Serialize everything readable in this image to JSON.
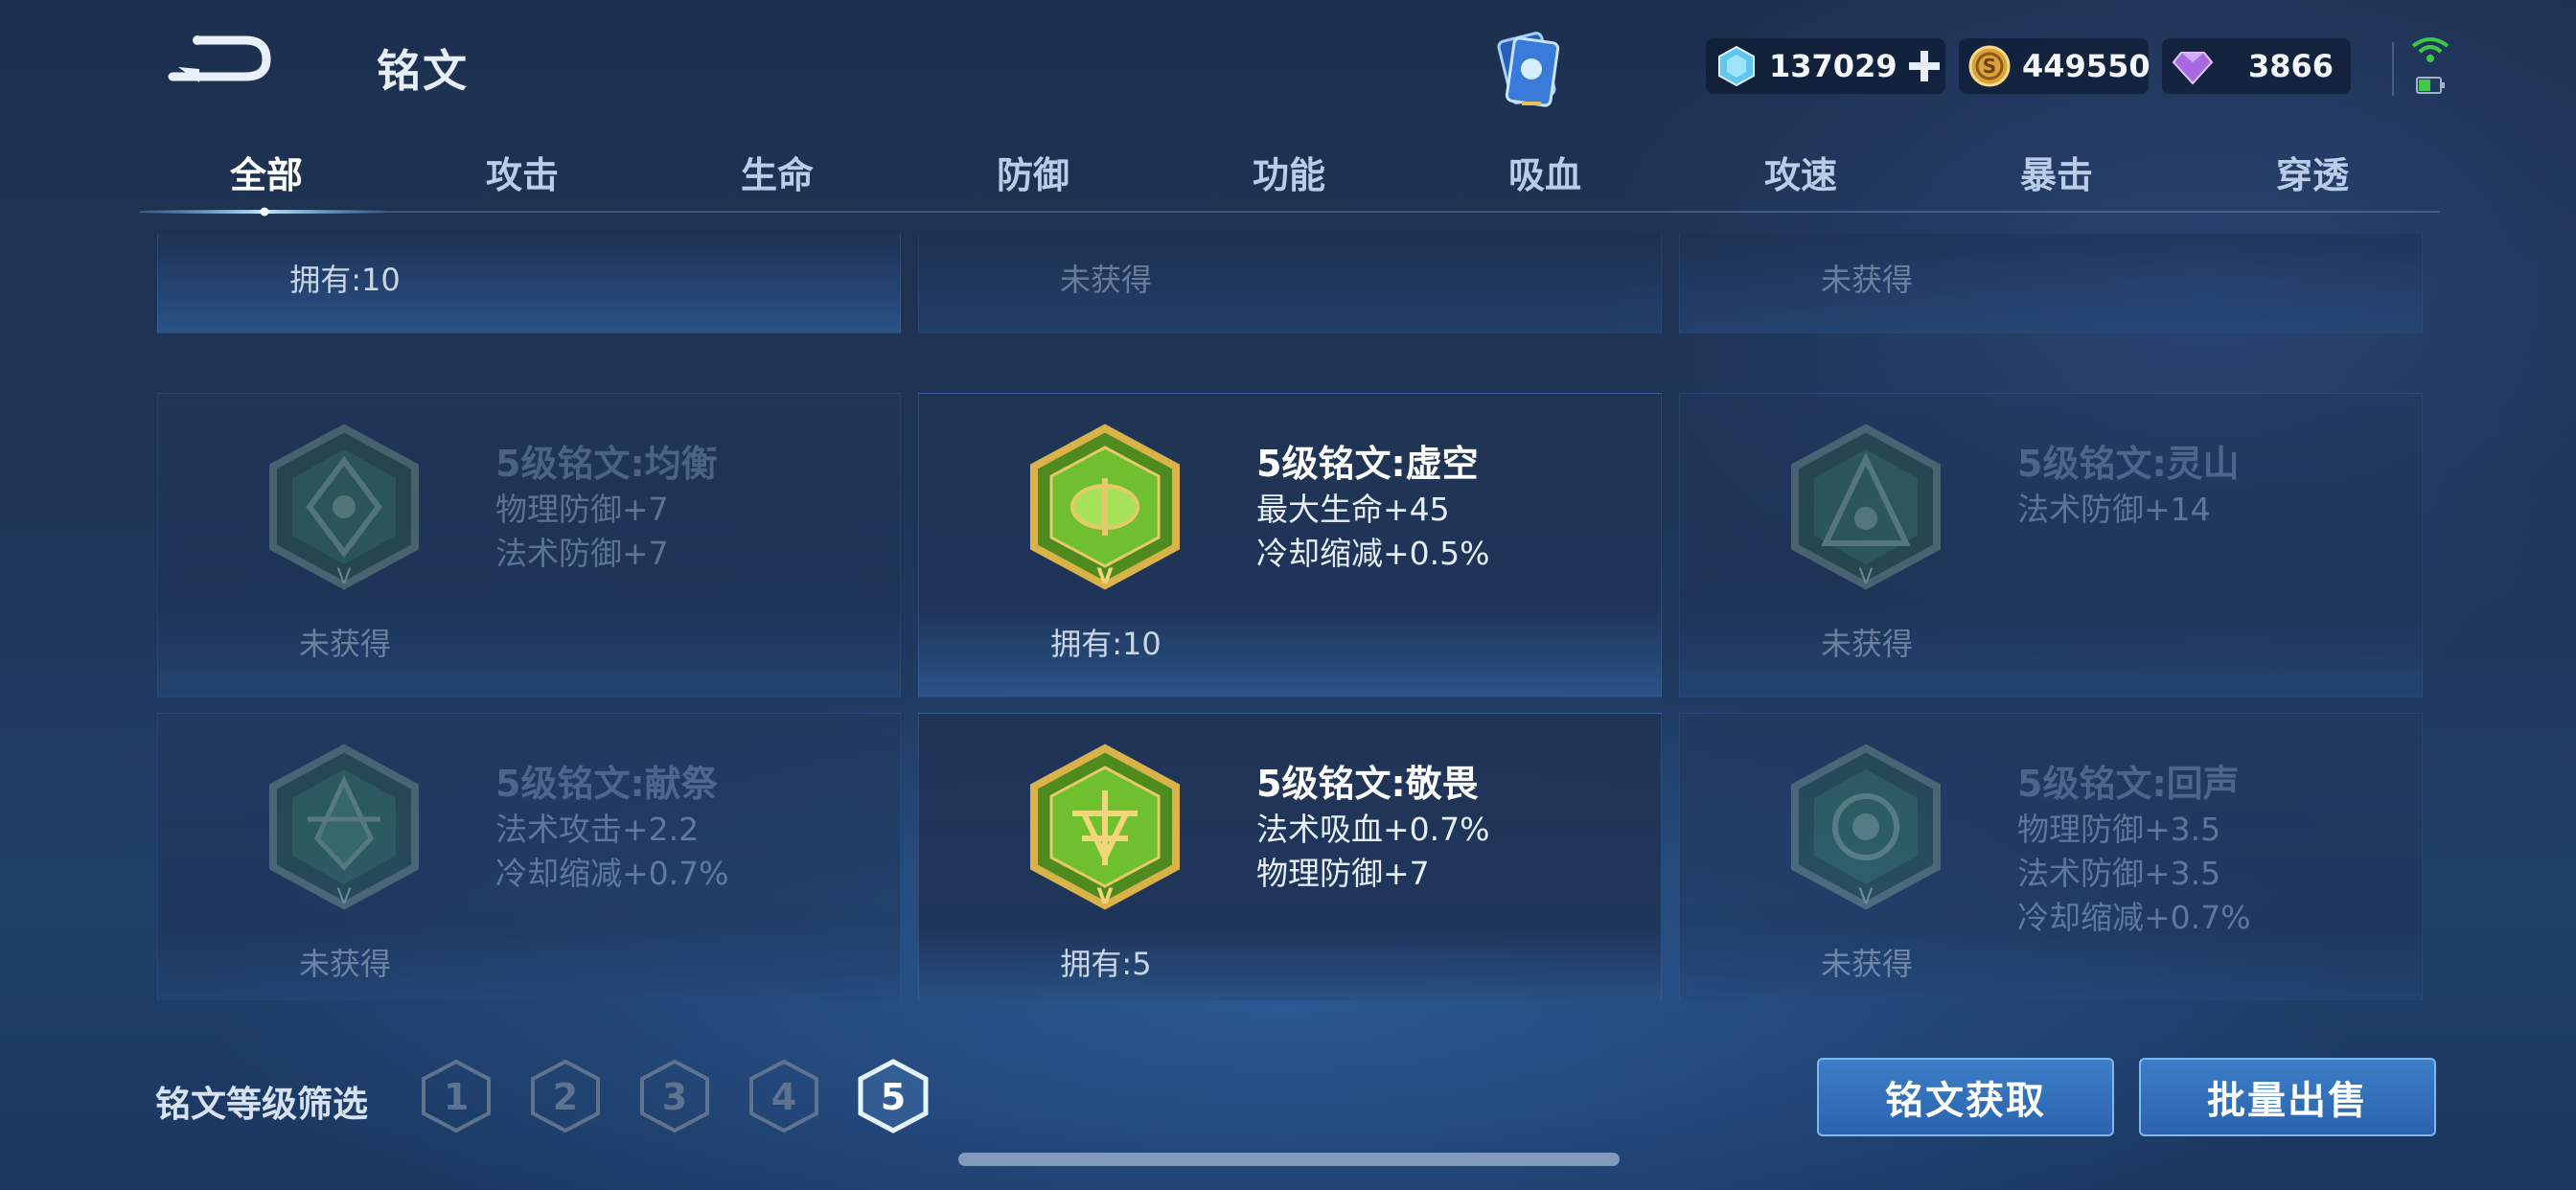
{
  "header": {
    "title": "铭文",
    "currencies": [
      {
        "name": "voucher",
        "value": "137029",
        "icon": "voucher-crystal-icon",
        "has_add": true
      },
      {
        "name": "gold",
        "value": "449550",
        "icon": "gold-coin-icon"
      },
      {
        "name": "gem",
        "value": "3866",
        "icon": "purple-gem-icon"
      }
    ]
  },
  "tabs": [
    {
      "label": "全部",
      "active": true
    },
    {
      "label": "攻击"
    },
    {
      "label": "生命"
    },
    {
      "label": "防御"
    },
    {
      "label": "功能"
    },
    {
      "label": "吸血"
    },
    {
      "label": "攻速"
    },
    {
      "label": "暴击"
    },
    {
      "label": "穿透"
    }
  ],
  "cards": [
    {
      "name": "",
      "stats": [],
      "status": "拥有:10",
      "owned": true,
      "partial": true
    },
    {
      "name": "",
      "stats": [],
      "status": "未获得",
      "owned": false,
      "partial": true
    },
    {
      "name": "",
      "stats": [],
      "status": "未获得",
      "owned": false,
      "partial": true
    },
    {
      "name": "5级铭文:均衡",
      "stats": [
        "物理防御+7",
        "法术防御+7"
      ],
      "status": "未获得",
      "owned": false
    },
    {
      "name": "5级铭文:虚空",
      "stats": [
        "最大生命+45",
        "冷却缩减+0.5%"
      ],
      "status": "拥有:10",
      "owned": true
    },
    {
      "name": "5级铭文:灵山",
      "stats": [
        "法术防御+14"
      ],
      "status": "未获得",
      "owned": false
    },
    {
      "name": "5级铭文:献祭",
      "stats": [
        "法术攻击+2.2",
        "冷却缩减+0.7%"
      ],
      "status": "未获得",
      "owned": false
    },
    {
      "name": "5级铭文:敬畏",
      "stats": [
        "法术吸血+0.7%",
        "物理防御+7"
      ],
      "status": "拥有:5",
      "owned": true
    },
    {
      "name": "5级铭文:回声",
      "stats": [
        "物理防御+3.5",
        "法术防御+3.5",
        "冷却缩减+0.7%"
      ],
      "status": "未获得",
      "owned": false
    }
  ],
  "filter": {
    "label": "铭文等级筛选",
    "levels": [
      "1",
      "2",
      "3",
      "4",
      "5"
    ],
    "selected": "5"
  },
  "buttons": {
    "obtain": "铭文获取",
    "bulk_sell": "批量出售"
  },
  "colors": {
    "accent": "#3d7ec8",
    "owned_emblem": "#6fbf2e",
    "gold": "#d9b24a"
  }
}
